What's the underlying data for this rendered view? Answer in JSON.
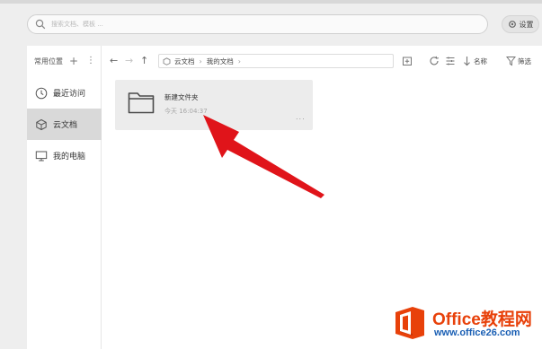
{
  "search": {
    "placeholder": "搜索文档、模板 ..."
  },
  "settings_label": "设置",
  "sidebar": {
    "header": "常用位置",
    "plus_icon": "+",
    "more_icon": "⋮",
    "items": [
      {
        "label": "最近访问",
        "icon": "clock-icon"
      },
      {
        "label": "云文档",
        "icon": "cube-icon",
        "active": true
      },
      {
        "label": "我的电脑",
        "icon": "monitor-icon"
      }
    ]
  },
  "toolbar": {
    "back": "←",
    "forward": "→",
    "up": "↑",
    "breadcrumb": [
      "云文档",
      "我的文档"
    ],
    "sort_label": "名称",
    "filter_label": "筛选"
  },
  "folder": {
    "name": "新建文件夹",
    "time": "今天 16:04:37",
    "more": "..."
  },
  "watermark": {
    "title": "Office教程网",
    "url": "www.office26.com"
  },
  "colors": {
    "accent_arrow": "#e0141a",
    "watermark_orange": "#e8410a",
    "watermark_blue": "#1a5fb4",
    "active_sidebar": "#d9d9d9"
  }
}
